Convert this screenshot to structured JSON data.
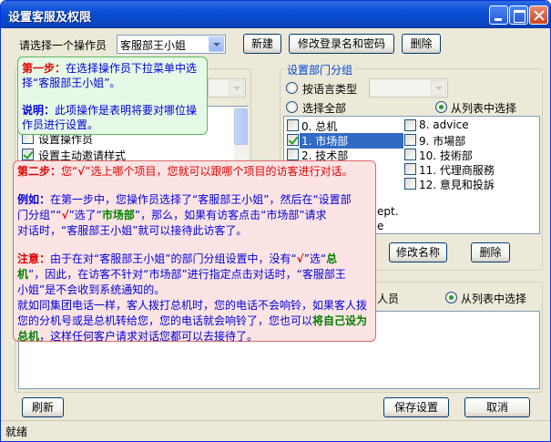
{
  "window": {
    "title": "设置客服及权限"
  },
  "top": {
    "operator_label": "请选择一个操作员",
    "operator_value": "客服部王小姐",
    "new_button": "新建",
    "modify_button": "修改登录名和密码",
    "delete_button": "删除"
  },
  "left_panel": {
    "permissions": [
      {
        "label": "设置操作员",
        "checked": false
      },
      {
        "label": "设置主动邀请样式",
        "checked": true
      }
    ]
  },
  "dept_group": {
    "title": "设置部门分组",
    "radio_by_language": "按语言类型",
    "radio_select_all": "选择全部",
    "radio_from_list": "从列表中选择",
    "items_left": [
      {
        "label": "0. 总机",
        "checked": false
      },
      {
        "label": "1. 市场部",
        "checked": true,
        "selected": true
      },
      {
        "label": "2. 技术部",
        "checked": false
      }
    ],
    "items_right": [
      {
        "label": "8. advice",
        "checked": false
      },
      {
        "label": "9. 市場部",
        "checked": false
      },
      {
        "label": "10. 技術部",
        "checked": false
      },
      {
        "label": "11. 代理商服務",
        "checked": false
      },
      {
        "label": "12. 意見和投訴",
        "checked": false
      }
    ],
    "partial_line_1": "ept.",
    "partial_line_2": "e",
    "rename_button": "修改名称",
    "delete_button": "删除"
  },
  "staff_group": {
    "partial_label": "人员",
    "radio_from_list": "从列表中选择"
  },
  "bottom": {
    "refresh_button": "刷新",
    "save_button": "保存设置",
    "cancel_button": "取消"
  },
  "status": {
    "text": "就绪"
  },
  "tip1": {
    "step_label": "第一步：",
    "step_text_a": "在选择操作员下拉菜单中选",
    "step_text_b": "择“客服部王小姐”。",
    "note_label": "说明：",
    "note_text_a": "此项操作是表明将要对哪位操",
    "note_text_b": "作员进行设置。"
  },
  "tip2": {
    "step_label": "第二步：",
    "step_text_a": "您“",
    "check_mark": "√",
    "step_text_b": "”选上哪个项目，您就可以跟哪个项目的访客进行对话。",
    "ex_label": "例如：",
    "ex_a": "在第一步中，您操作员选择了“客服部王小姐”，然后在“设置部",
    "ex_b1": "门分组”“",
    "ex_b2": "”选了“",
    "ex_b3": "市场部",
    "ex_b4": "”，那么，如果有访客点击“市场部”请求",
    "ex_c": "对话时，“客服部王小姐”就可以接待此访客了。",
    "warn_label": "注意：",
    "warn_a1": "由于在对“客服部王小姐”的部门分组设置中，没有“",
    "warn_a2": "”选“",
    "warn_a3": "总",
    "warn_b1": "机",
    "warn_b2": "”，因此，在访客不针对“市场部”进行指定点击对话时，“客服部王",
    "warn_c": "小姐”是不会收到系统通知的。",
    "para_a": "就如同集团电话一样，客人拨打总机时，您的电话不会响铃，如果客人拨",
    "para_b1": "您的分机号或是总机转给您，您的电话就会响铃了，您也可以",
    "para_b2": "将自己设为",
    "para_c1": "总机",
    "para_c2": "，这样任何客户请求对话您都可以去接待了。"
  }
}
